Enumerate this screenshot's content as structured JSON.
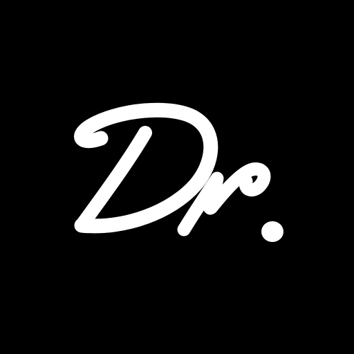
{
  "logo": {
    "wordmark": "Dr.",
    "background_color": "#000000",
    "ink_color": "#ffffff"
  }
}
